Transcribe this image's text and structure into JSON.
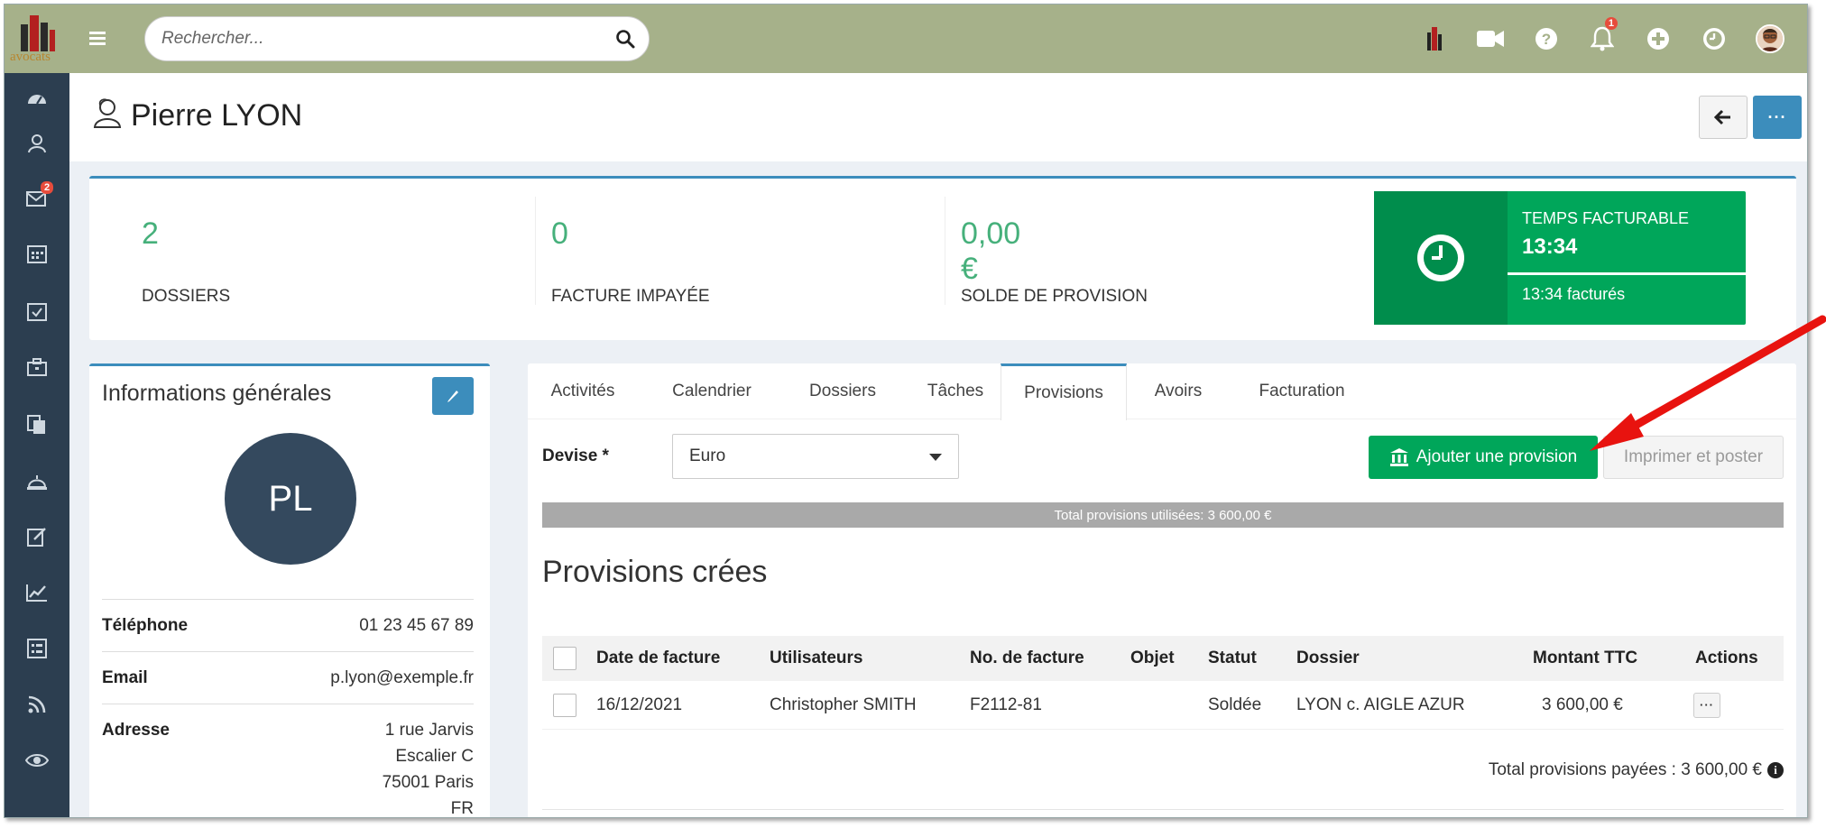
{
  "topbar": {
    "logo_text": "avocats",
    "search_placeholder": "Rechercher...",
    "notification_count": "1",
    "icons": [
      "app-logo-icon",
      "video-icon",
      "help-icon",
      "bell-icon",
      "plus-circle-icon",
      "clock-icon",
      "user-avatar"
    ]
  },
  "sidebar": {
    "items": [
      "dashboard-icon",
      "contacts-icon",
      "mail-icon",
      "calendar-icon",
      "tasks-icon",
      "briefcase-icon",
      "documents-icon",
      "reception-icon",
      "edit-icon",
      "chart-icon",
      "list-icon",
      "rss-icon",
      "eye-icon"
    ],
    "mail_badge": "2"
  },
  "header": {
    "title": "Pierre LYON",
    "more_label": "···"
  },
  "stats": [
    {
      "value": "2",
      "label": "DOSSIERS"
    },
    {
      "value": "0",
      "label": "FACTURE IMPAYÉE"
    },
    {
      "value": "0,00 €",
      "label": "SOLDE DE PROVISION"
    }
  ],
  "time_box": {
    "title": "TEMPS FACTURABLE",
    "value": "13:34",
    "billed": "13:34 facturés"
  },
  "info": {
    "title": "Informations générales",
    "initials": "PL",
    "phone_label": "Téléphone",
    "phone": "01 23 45 67 89",
    "email_label": "Email",
    "email": "p.lyon@exemple.fr",
    "address_label": "Adresse",
    "address_lines": [
      "1 rue Jarvis",
      "Escalier C",
      "75001 Paris",
      "FR"
    ]
  },
  "tabs": [
    "Activités",
    "Calendrier",
    "Dossiers",
    "Tâches",
    "Provisions",
    "Avoirs",
    "Facturation"
  ],
  "active_tab": "Provisions",
  "provisions": {
    "devise_label": "Devise *",
    "devise_value": "Euro",
    "add_button": "Ajouter une provision",
    "print_button": "Imprimer et poster",
    "progress_text": "Total provisions utilisées: 3 600,00 €",
    "section_title": "Provisions crées",
    "columns": [
      "Date de facture",
      "Utilisateurs",
      "No. de facture",
      "Objet",
      "Statut",
      "Dossier",
      "Montant TTC",
      "Actions"
    ],
    "rows": [
      {
        "date": "16/12/2021",
        "user": "Christopher SMITH",
        "number": "F2112-81",
        "object": "",
        "status": "Soldée",
        "dossier": "LYON c. AIGLE AZUR",
        "amount": "3 600,00 €"
      }
    ],
    "total_text": "Total provisions payées : 3 600,00 €"
  },
  "colors": {
    "topbar": "#a6b18a",
    "sidebar": "#2c3e50",
    "primary": "#3c8dbc",
    "success": "#00a65a",
    "stat_number": "#46b07b",
    "annotation_arrow": "#e8130f"
  }
}
